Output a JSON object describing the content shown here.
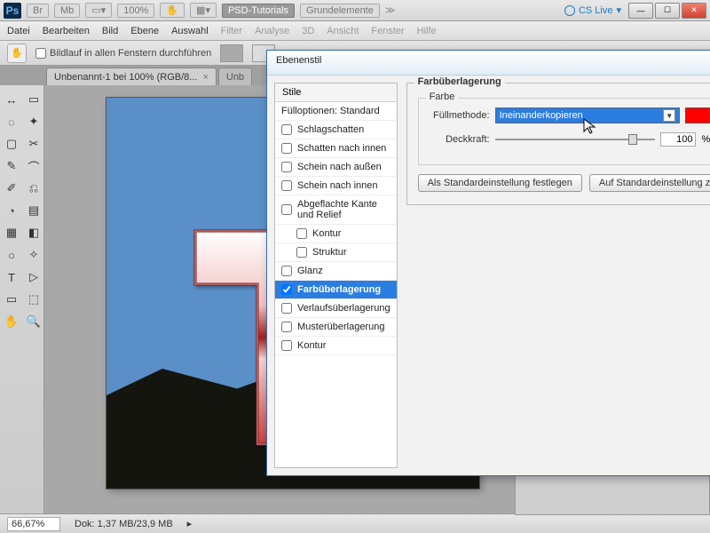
{
  "titlebar": {
    "zoom": "100%",
    "btn_tutorials": "PSD-Tutorials",
    "btn_grundelemente": "Grundelemente",
    "cs_live": "CS Live"
  },
  "menu": {
    "items": [
      "Datei",
      "Bearbeiten",
      "Bild",
      "Ebene",
      "Auswahl",
      "Filter",
      "Analyse",
      "3D",
      "Ansicht",
      "Fenster",
      "Hilfe"
    ]
  },
  "options": {
    "scroll_all_label": "Bildlauf in allen Fenstern durchführen"
  },
  "tabs": [
    {
      "label": "Unbenannt-1 bei 100% (RGB/8...",
      "active": true
    },
    {
      "label": "Unb",
      "active": false
    }
  ],
  "status": {
    "zoom": "66,67%",
    "doc": "Dok: 1,37 MB/23,9 MB"
  },
  "dialog": {
    "title": "Ebenenstil",
    "styles_header": "Stile",
    "fill_options": "Fülloptionen: Standard",
    "styles": [
      {
        "label": "Schlagschatten",
        "checked": false
      },
      {
        "label": "Schatten nach innen",
        "checked": false
      },
      {
        "label": "Schein nach außen",
        "checked": false
      },
      {
        "label": "Schein nach innen",
        "checked": false
      },
      {
        "label": "Abgeflachte Kante und Relief",
        "checked": false
      },
      {
        "label": "Kontur",
        "checked": false,
        "sub": true
      },
      {
        "label": "Struktur",
        "checked": false,
        "sub": true
      },
      {
        "label": "Glanz",
        "checked": false
      },
      {
        "label": "Farbüberlagerung",
        "checked": true,
        "selected": true
      },
      {
        "label": "Verlaufsüberlagerung",
        "checked": false
      },
      {
        "label": "Musterüberlagerung",
        "checked": false
      },
      {
        "label": "Kontur",
        "checked": false
      }
    ],
    "section_title": "Farbüberlagerung",
    "inner_title": "Farbe",
    "blend_label": "Füllmethode:",
    "blend_value": "Ineinanderkopieren",
    "opacity_label": "Deckkraft:",
    "opacity_value": "100",
    "opacity_unit": "%",
    "btn_set_default": "Als Standardeinstellung festlegen",
    "btn_reset_default": "Auf Standardeinstellung z",
    "color_swatch": "#ff0000"
  },
  "tools": [
    "▲",
    "▭",
    "◌",
    "✦",
    "▢",
    "✂",
    "✎",
    "⌒",
    "✐",
    "⎌",
    "◔",
    "▤",
    "✚",
    "◧",
    "T",
    "▷",
    "✧",
    "◉",
    "⬚",
    "⤢",
    "⊕",
    "⬛",
    "⬜"
  ]
}
